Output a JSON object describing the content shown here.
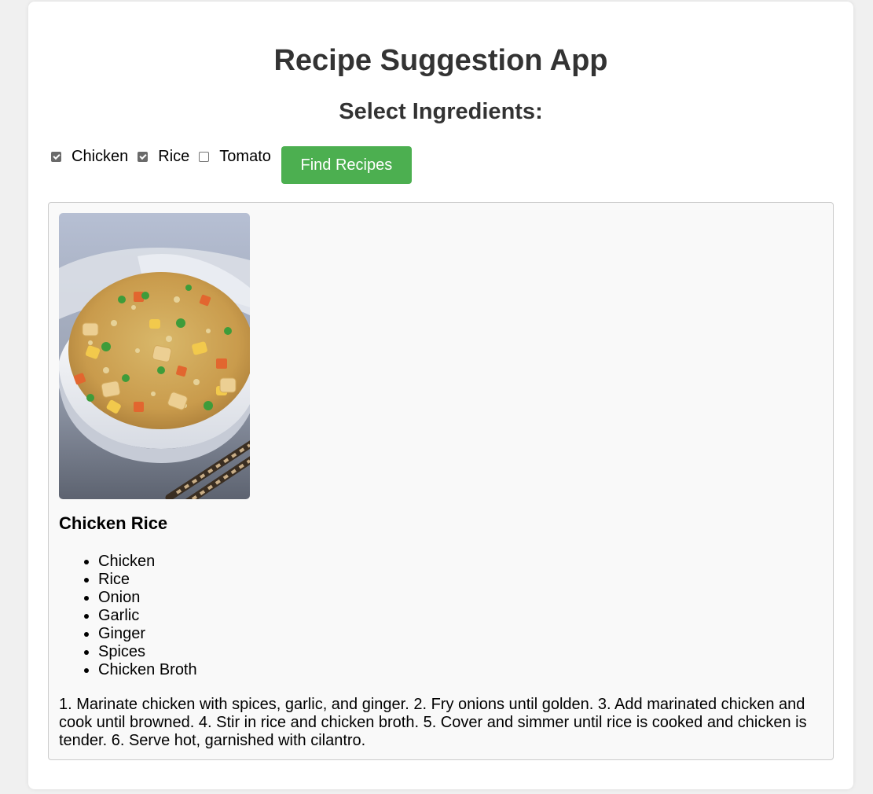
{
  "app": {
    "title": "Recipe Suggestion App",
    "section_title": "Select Ingredients:"
  },
  "ingredients": [
    {
      "label": "Chicken",
      "checked": true
    },
    {
      "label": "Rice",
      "checked": true
    },
    {
      "label": "Tomato",
      "checked": false
    }
  ],
  "find_button": {
    "label": "Find Recipes"
  },
  "recipe": {
    "image": "chicken-fried-rice-photo",
    "name": "Chicken Rice",
    "ingredients": [
      "Chicken",
      "Rice",
      "Onion",
      "Garlic",
      "Ginger",
      "Spices",
      "Chicken Broth"
    ],
    "instructions": "1. Marinate chicken with spices, garlic, and ginger. 2. Fry onions until golden. 3. Add marinated chicken and cook until browned. 4. Stir in rice and chicken broth. 5. Cover and simmer until rice is cooked and chicken is tender. 6. Serve hot, garnished with cilantro."
  },
  "colors": {
    "accent": "#4caf50",
    "background": "#f0f0f0",
    "card": "#f9f9f9",
    "heading": "#333333"
  }
}
